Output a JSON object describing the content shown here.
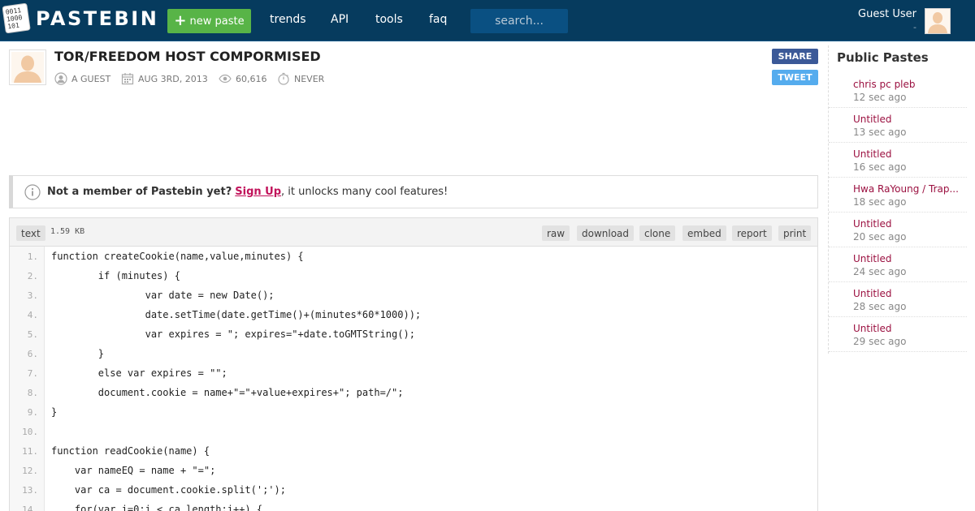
{
  "header": {
    "logo_text": "PASTEBIN",
    "new_paste_label": "new paste",
    "nav": [
      "trends",
      "API",
      "tools",
      "faq"
    ],
    "search_placeholder": "search...",
    "user_name": "Guest User",
    "user_sub": "-"
  },
  "paste": {
    "title": "TOR/FREEDOM HOST COMPORMISED",
    "author": "A GUEST",
    "date": "AUG 3RD, 2013",
    "views": "60,616",
    "expires": "NEVER",
    "share_label": "SHARE",
    "tweet_label": "TWEET"
  },
  "notice": {
    "lead": "Not a member of Pastebin yet?",
    "link": "Sign Up",
    "rest": ", it unlocks many cool features!"
  },
  "code": {
    "syntax": "text",
    "size": "1.59 KB",
    "actions": [
      "raw",
      "download",
      "clone",
      "embed",
      "report",
      "print"
    ],
    "lines": [
      "function createCookie(name,value,minutes) {",
      "        if (minutes) {",
      "                var date = new Date();",
      "                date.setTime(date.getTime()+(minutes*60*1000));",
      "                var expires = \"; expires=\"+date.toGMTString();",
      "        }",
      "        else var expires = \"\";",
      "        document.cookie = name+\"=\"+value+expires+\"; path=/\";",
      "}",
      "",
      "function readCookie(name) {",
      "    var nameEQ = name + \"=\";",
      "    var ca = document.cookie.split(';');",
      "    for(var i=0;i < ca.length;i++) {"
    ]
  },
  "sidebar": {
    "title": "Public Pastes",
    "items": [
      {
        "title": "chris pc pleb",
        "time": "12 sec ago"
      },
      {
        "title": "Untitled",
        "time": "13 sec ago"
      },
      {
        "title": "Untitled",
        "time": "16 sec ago"
      },
      {
        "title": "Hwa RaYoung / Trap...",
        "time": "18 sec ago"
      },
      {
        "title": "Untitled",
        "time": "20 sec ago"
      },
      {
        "title": "Untitled",
        "time": "24 sec ago"
      },
      {
        "title": "Untitled",
        "time": "28 sec ago"
      },
      {
        "title": "Untitled",
        "time": "29 sec ago"
      }
    ]
  }
}
